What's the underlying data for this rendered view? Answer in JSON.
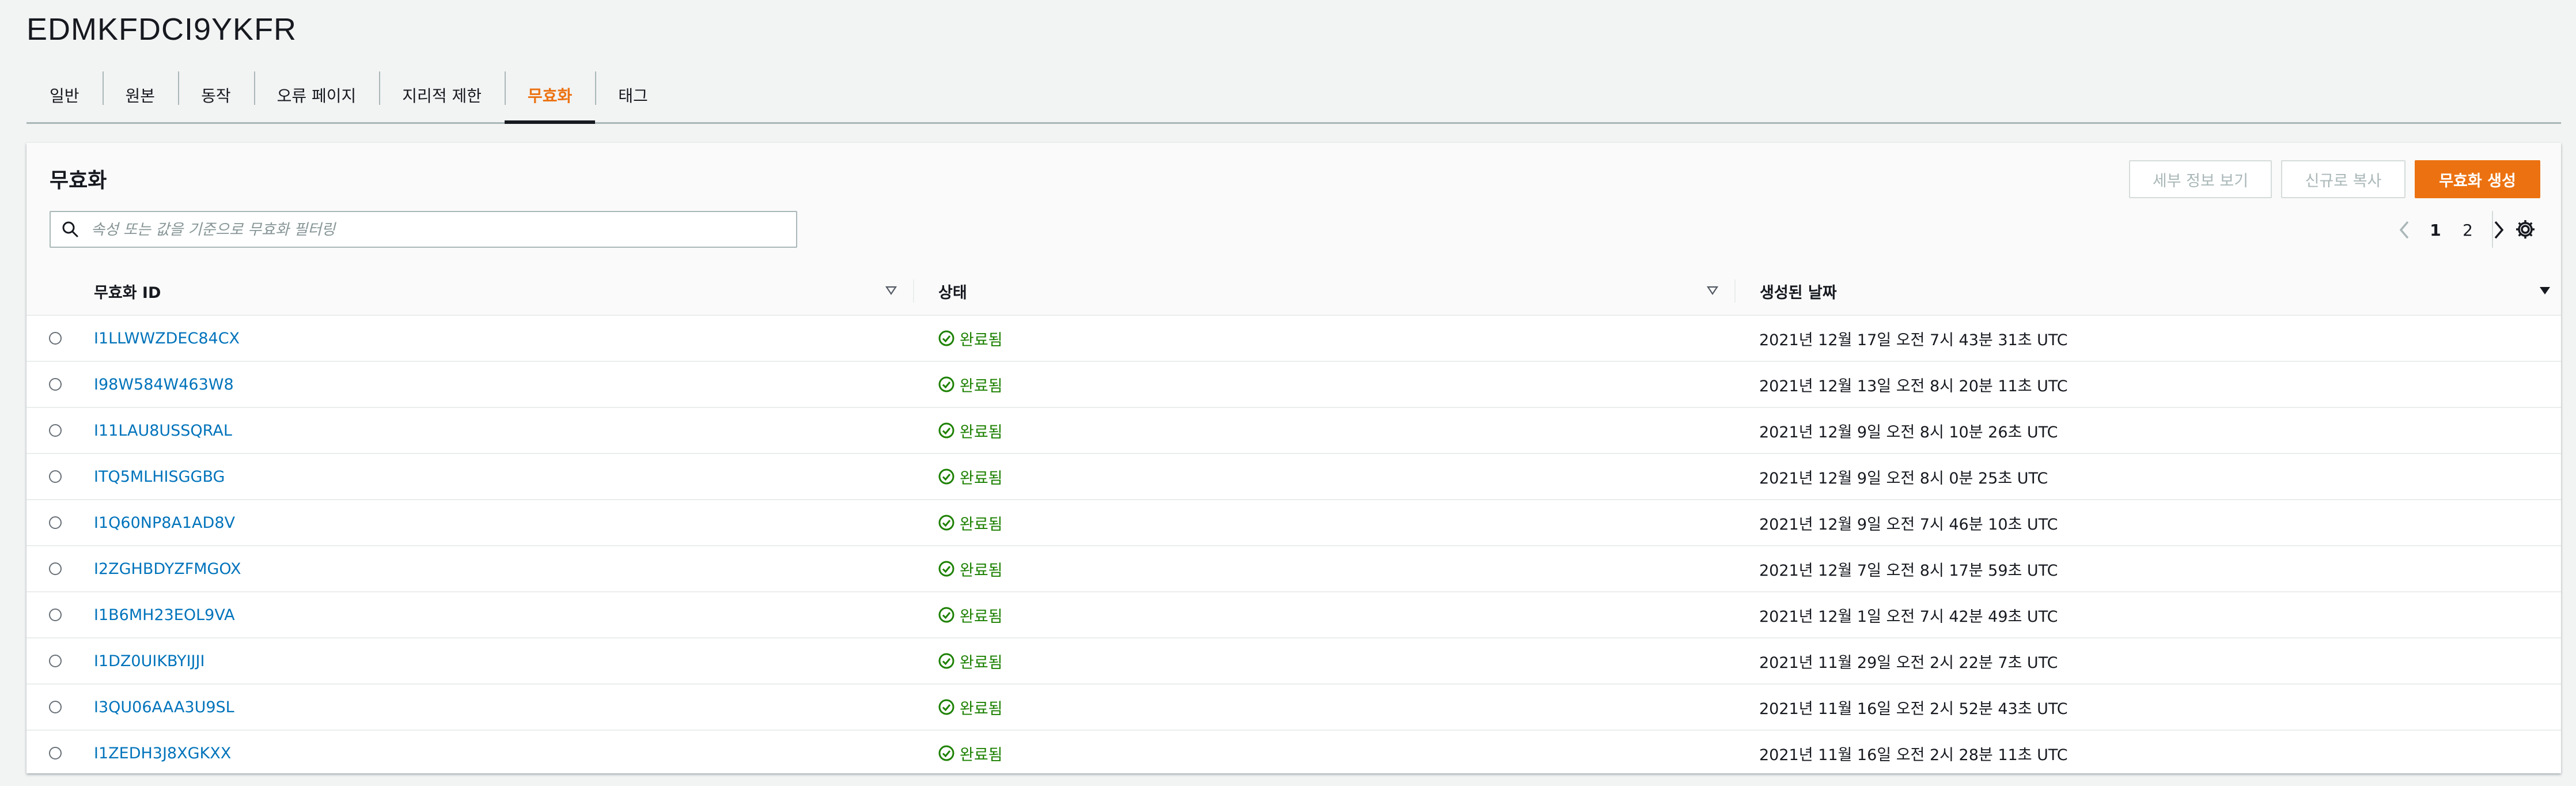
{
  "page": {
    "title": "EDMKFDCI9YKFR"
  },
  "tabs": [
    {
      "label": "일반",
      "active": false
    },
    {
      "label": "원본",
      "active": false
    },
    {
      "label": "동작",
      "active": false
    },
    {
      "label": "오류 페이지",
      "active": false
    },
    {
      "label": "지리적 제한",
      "active": false
    },
    {
      "label": "무효화",
      "active": true
    },
    {
      "label": "태그",
      "active": false
    }
  ],
  "panel": {
    "title": "무효화",
    "buttons": {
      "details": "세부 정보 보기",
      "copy": "신규로 복사",
      "create": "무효화 생성"
    },
    "search": {
      "placeholder": "속성 또는 값을 기준으로 무효화 필터링"
    },
    "pagination": {
      "pages": [
        "1",
        "2"
      ],
      "current": "1"
    }
  },
  "table": {
    "columns": [
      "무효화 ID",
      "상태",
      "생성된 날짜"
    ],
    "rows": [
      {
        "id": "I1LLWWZDEC84CX",
        "status": "완료됨",
        "date": "2021년 12월 17일 오전 7시 43분 31초 UTC"
      },
      {
        "id": "I98W584W463W8",
        "status": "완료됨",
        "date": "2021년 12월 13일 오전 8시 20분 11초 UTC"
      },
      {
        "id": "I11LAU8USSQRAL",
        "status": "완료됨",
        "date": "2021년 12월 9일 오전 8시 10분 26초 UTC"
      },
      {
        "id": "ITQ5MLHISGGBG",
        "status": "완료됨",
        "date": "2021년 12월 9일 오전 8시 0분 25초 UTC"
      },
      {
        "id": "I1Q60NP8A1AD8V",
        "status": "완료됨",
        "date": "2021년 12월 9일 오전 7시 46분 10초 UTC"
      },
      {
        "id": "I2ZGHBDYZFMGOX",
        "status": "완료됨",
        "date": "2021년 12월 7일 오전 8시 17분 59초 UTC"
      },
      {
        "id": "I1B6MH23EOL9VA",
        "status": "완료됨",
        "date": "2021년 12월 1일 오전 7시 42분 49초 UTC"
      },
      {
        "id": "I1DZ0UIKBYIJJI",
        "status": "완료됨",
        "date": "2021년 11월 29일 오전 2시 22분 7초 UTC"
      },
      {
        "id": "I3QU06AAA3U9SL",
        "status": "완료됨",
        "date": "2021년 11월 16일 오전 2시 52분 43초 UTC"
      },
      {
        "id": "I1ZEDH3J8XGKXX",
        "status": "완료됨",
        "date": "2021년 11월 16일 오전 2시 28분 11초 UTC"
      }
    ]
  },
  "colors": {
    "accent": "#ec7211",
    "link": "#0073bb",
    "success": "#1d8102"
  },
  "icons": {
    "search": "search-icon",
    "prev": "chevron-left-icon",
    "next": "chevron-right-icon",
    "settings": "gear-icon",
    "status": "check-circle-icon",
    "sort": "sort-caret-icon"
  }
}
